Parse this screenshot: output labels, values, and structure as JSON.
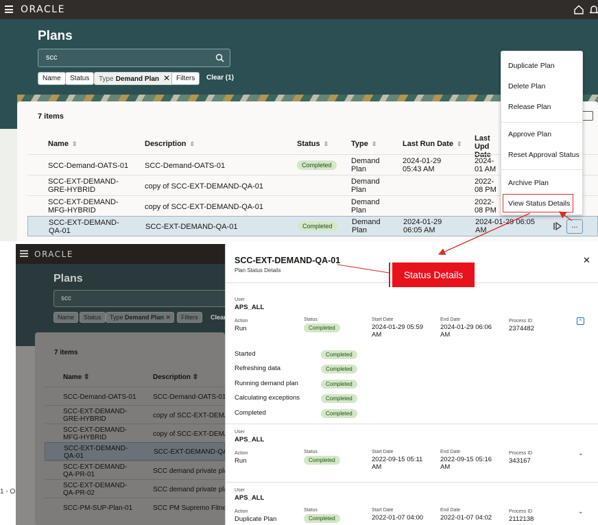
{
  "top": {
    "brand": "ORACLE",
    "page_title": "Plans",
    "search_value": "scc",
    "chips": {
      "name": "Name",
      "status": "Status",
      "type_label": "Type",
      "type_value": "Demand Plan",
      "filters": "Filters",
      "clear": "Clear (1)"
    },
    "items_count": "7 items",
    "columns": {
      "name": "Name",
      "description": "Description",
      "status": "Status",
      "type": "Type",
      "last_run": "Last Run Date",
      "last_updated": "Last Upd Date"
    },
    "rows": [
      {
        "name": "SCC-Demand-OATS-01",
        "desc": "SCC-Demand-OATS-01",
        "status": "Completed",
        "type": "Demand Plan",
        "last_run": "2024-01-29 05:43 AM",
        "last_upd": "2024-01 AM"
      },
      {
        "name": "SCC-EXT-DEMAND-GRE-HYBRID",
        "desc": "copy of SCC-EXT-DEMAND-QA-01",
        "status": "",
        "type": "Demand Plan",
        "last_run": "",
        "last_upd": "2022-08 PM"
      },
      {
        "name": "SCC-EXT-DEMAND-MFG-HYBRID",
        "desc": "copy of SCC-EXT-DEMAND-QA-01",
        "status": "",
        "type": "Demand Plan",
        "last_run": "",
        "last_upd": "2022-08 PM"
      },
      {
        "name": "SCC-EXT-DEMAND-QA-01",
        "desc": "SCC-EXT-DEMAND-QA-01",
        "status": "Completed",
        "type": "Demand Plan",
        "last_run": "2024-01-29 06:05 AM",
        "last_upd": "2024-01-29 06:05 AM"
      }
    ],
    "actions_menu": [
      "Duplicate Plan",
      "Delete Plan",
      "Release Plan",
      "Approve Plan",
      "Reset Approval Status",
      "Archive Plan",
      "View Status Details"
    ],
    "more_button": "..."
  },
  "bottom": {
    "brand": "ORACLE",
    "page_title": "Plans",
    "search_value": "scc",
    "chips": {
      "name": "Name",
      "status": "Status",
      "type_label": "Type",
      "type_value": "Demand Plan",
      "filters": "Filters",
      "clear": "Clear"
    },
    "items_count": "7 items",
    "columns": {
      "name": "Name",
      "description": "Description"
    },
    "rows": [
      {
        "name": "SCC-Demand-OATS-01",
        "desc": "SCC-Demand-OATS-01"
      },
      {
        "name": "SCC-EXT-DEMAND-GRE-HYBRID",
        "desc": "copy of SCC-EXT-DEMAN"
      },
      {
        "name": "SCC-EXT-DEMAND-MFG-HYBRID",
        "desc": "copy of SCC-EXT-DEMAN"
      },
      {
        "name": "SCC-EXT-DEMAND-QA-01",
        "desc": "SCC-EXT-DEMAND-QA-0"
      },
      {
        "name": "SCC-EXT-DEMAND-QA-PR-01",
        "desc": "SCC demand private plan"
      },
      {
        "name": "SCC-EXT-DEMAND-QA-PR-02",
        "desc": "SCC demand private plan"
      },
      {
        "name": "SCC-PM-SUP-Plan-01",
        "desc": "SCC PM Supremo Fitness"
      }
    ],
    "left_cut_text": "1 - O"
  },
  "drawer": {
    "title": "SCC-EXT-DEMAND-QA-01",
    "subtitle": "Plan Status Details",
    "labels": {
      "user": "User",
      "action": "Action",
      "status": "Status",
      "start": "Start Date",
      "end": "End Date",
      "process": "Process ID"
    },
    "entries": [
      {
        "user": "APS_ALL",
        "action": "Run",
        "status": "Completed",
        "start": "2024-01-29 05:59 AM",
        "end": "2024-01-29 06:06 AM",
        "process": "2374482"
      },
      {
        "user": "APS_ALL",
        "action": "Run",
        "status": "Completed",
        "start": "2022-09-15 05:11 AM",
        "end": "2022-09-15 05:16 AM",
        "process": "343167"
      },
      {
        "user": "APS_ALL",
        "action": "Duplicate Plan",
        "status": "Completed",
        "start": "2022-01-07 04:00",
        "end": "2022-01-07 04:02",
        "process": "2112138"
      }
    ],
    "steps": [
      {
        "name": "Started",
        "status": "Completed"
      },
      {
        "name": "Refreshing data",
        "status": "Completed"
      },
      {
        "name": "Running demand plan",
        "status": "Completed"
      },
      {
        "name": "Calculating exceptions",
        "status": "Completed"
      },
      {
        "name": "Completed",
        "status": "Completed"
      }
    ]
  },
  "callout": "Status Details",
  "colors": {
    "header": "#312d2a",
    "hero": "#2b4f53",
    "badge": "#d4e7c8",
    "annotation": "#e8121c"
  }
}
